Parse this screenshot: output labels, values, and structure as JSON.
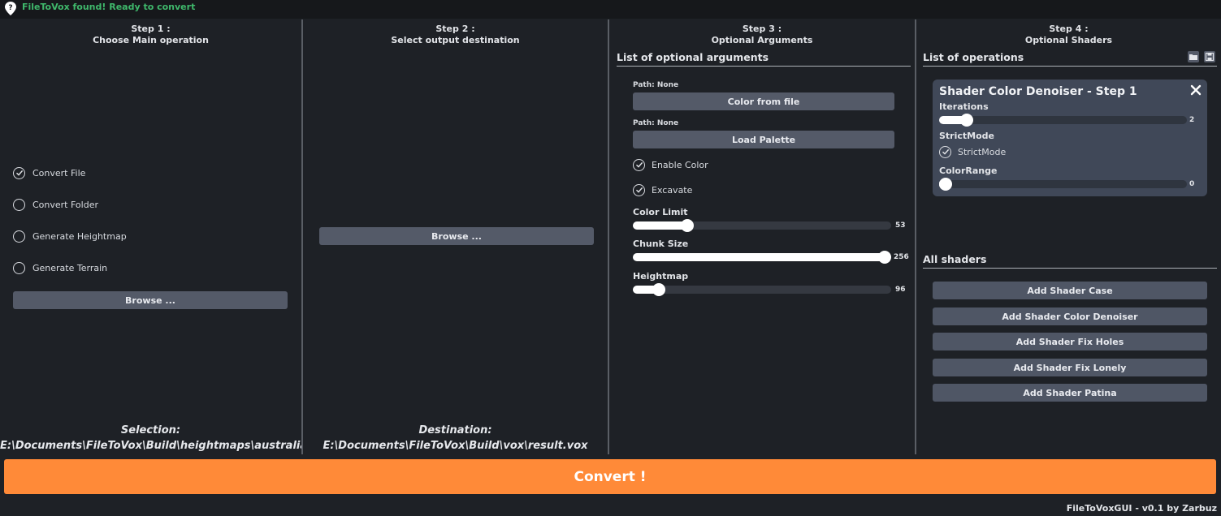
{
  "status": {
    "text": "FileToVox found! Ready to convert",
    "color": "#3fb86b"
  },
  "step1": {
    "heading": "Step 1 :",
    "subheading": "Choose Main operation",
    "options": [
      {
        "label": "Convert File",
        "selected": true
      },
      {
        "label": "Convert Folder",
        "selected": false
      },
      {
        "label": "Generate Heightmap",
        "selected": false
      },
      {
        "label": "Generate Terrain",
        "selected": false
      }
    ],
    "browse_label": "Browse ...",
    "selection_title": "Selection:",
    "selection_path": "E:\\Documents\\FileToVox\\Build\\heightmaps\\australia-c"
  },
  "step2": {
    "heading": "Step 2 :",
    "subheading": "Select output destination",
    "browse_label": "Browse ...",
    "destination_title": "Destination:",
    "destination_path": "E:\\Documents\\FileToVox\\Build\\vox\\result.vox"
  },
  "step3": {
    "heading": "Step 3 :",
    "subheading": "Optional Arguments",
    "section_title": "List of optional arguments",
    "color_file": {
      "path_label": "Path: None",
      "button_label": "Color from file"
    },
    "palette": {
      "path_label": "Path: None",
      "button_label": "Load Palette"
    },
    "checks": [
      {
        "label": "Enable Color",
        "checked": true
      },
      {
        "label": "Excavate",
        "checked": true
      }
    ],
    "sliders": [
      {
        "label": "Color Limit",
        "value": "53",
        "fraction": 0.21
      },
      {
        "label": "Chunk Size",
        "value": "256",
        "fraction": 1.0
      },
      {
        "label": "Heightmap",
        "value": "96",
        "fraction": 0.1
      }
    ]
  },
  "step4": {
    "heading": "Step 4 :",
    "subheading": "Optional Shaders",
    "section_title": "List of operations",
    "open_icon": "folder-open-icon",
    "save_icon": "save-icon",
    "active_shader": {
      "title": "Shader Color Denoiser - Step 1",
      "iterations_label": "Iterations",
      "iterations_value": "2",
      "iterations_fraction": 0.11,
      "strict_label": "StrictMode",
      "strict_check_label": "StrictMode",
      "strict_checked": true,
      "range_label": "ColorRange",
      "range_value": "0",
      "range_fraction": 0.0
    },
    "all_title": "All shaders",
    "add_buttons": [
      "Add Shader Case",
      "Add Shader Color Denoiser",
      "Add Shader Fix Holes",
      "Add Shader Fix Lonely",
      "Add Shader Patina"
    ]
  },
  "convert_label": "Convert !",
  "convert_color": "#ff8a38",
  "footer": "FileToVoxGUI - v0.1 by Zarbuz"
}
